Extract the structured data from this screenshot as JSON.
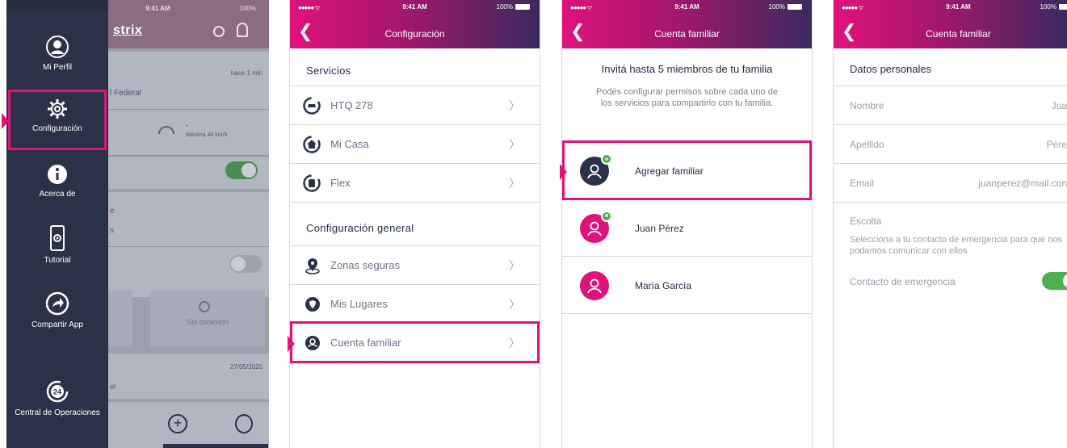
{
  "statusbar": {
    "time": "9:41 AM",
    "battery": "100%",
    "signal": "●●●●● ᯤ"
  },
  "screen1": {
    "brand": "strix",
    "menu": [
      {
        "id": "perfil",
        "label": "Mi Perfil",
        "icon": "user-icon"
      },
      {
        "id": "configuracion",
        "label": "Configuración",
        "icon": "gear-icon"
      },
      {
        "id": "acerca",
        "label": "Acerca de",
        "icon": "info-icon"
      },
      {
        "id": "tutorial",
        "label": "Tutorial",
        "icon": "phone-play-icon"
      },
      {
        "id": "compartir",
        "label": "Compartir App",
        "icon": "share-icon"
      },
      {
        "id": "central",
        "label": "Central de Operaciones",
        "icon": "phone-24-icon"
      }
    ],
    "bg": {
      "time_ago": "hace 1 min",
      "location": "l Federal",
      "speed_dash": "-",
      "speed_max": "Máxima 44 km/h",
      "pink_text": "e",
      "gray_text": "s",
      "no_connection": "Sin conexión",
      "date": "27/05/2020",
      "name_fragment": "el"
    }
  },
  "screen2": {
    "title": "Configuración",
    "services_header": "Servicios",
    "services": [
      {
        "label": "HTQ 278",
        "icon": "car-icon"
      },
      {
        "label": "Mi Casa",
        "icon": "home-icon"
      },
      {
        "label": "Flex",
        "icon": "backpack-icon"
      }
    ],
    "general_header": "Configuración general",
    "general": [
      {
        "label": "Zonas seguras",
        "icon": "pin-icon"
      },
      {
        "label": "Mis Lugares",
        "icon": "shield-icon"
      },
      {
        "label": "Cuenta familiar",
        "icon": "family-user-icon"
      }
    ]
  },
  "screen3": {
    "title": "Cuenta familiar",
    "invite_title": "Invitá hasta 5 miembros de tu familia",
    "invite_desc": "Podés configurar permisos sobre cada uno de los servicios para compartirlo con tu familia.",
    "add_label": "Agregar familiar",
    "members": [
      {
        "name": "Juan Pérez"
      },
      {
        "name": "María García"
      }
    ]
  },
  "screen4": {
    "title": "Cuenta familiar",
    "section_title": "Datos personales",
    "fields": [
      {
        "label": "Nombre",
        "value": "Jua"
      },
      {
        "label": "Apellido",
        "value": "Pére"
      },
      {
        "label": "Email",
        "value": "juanperez@mail.con"
      }
    ],
    "escolta_title": "Escolta",
    "escolta_desc": "Selecciona a tu contacto de emergencia para que nos podamos comunicar con ellos",
    "emergency_label": "Contacto de emergencia"
  },
  "colors": {
    "accent": "#e0127a",
    "navy": "#2b3147",
    "green": "#4caf50"
  }
}
